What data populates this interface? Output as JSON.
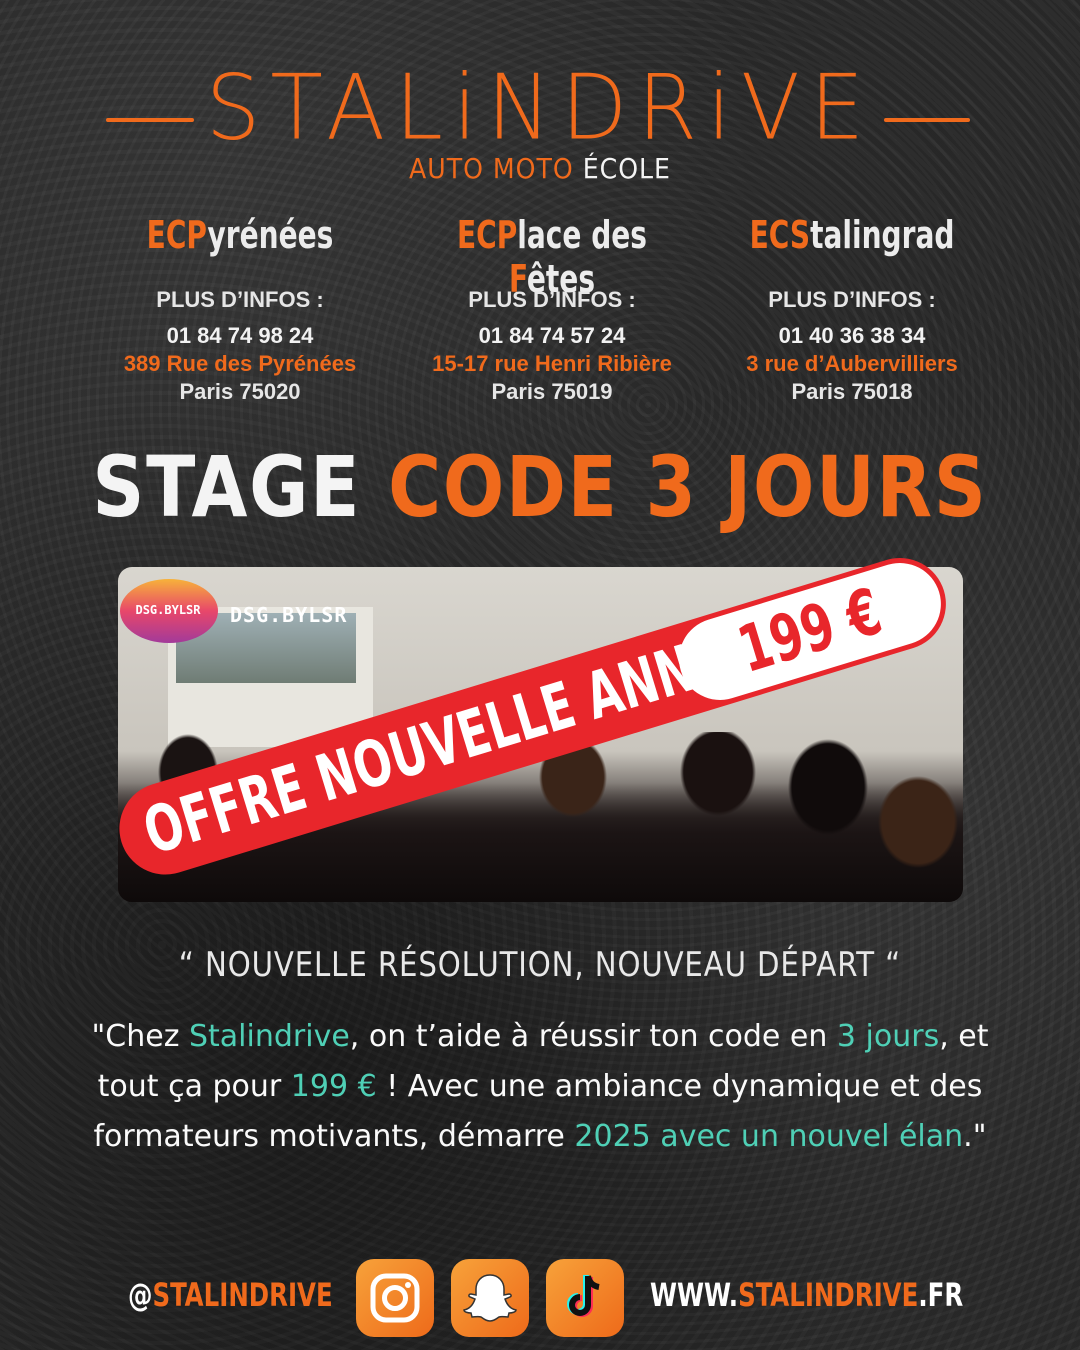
{
  "brand": {
    "name": "STALiNDRiVE",
    "sub_auto": "AUTO",
    "sub_moto": "MOTO",
    "sub_ecole": "ÉCOLE"
  },
  "schools": [
    {
      "prefix": "ECP",
      "rest": "yrénées",
      "info_label": "PLUS D’INFOS :",
      "phone": "01 84 74 98 24",
      "address": "389 Rue des Pyrénées",
      "city": "Paris 75020"
    },
    {
      "prefix": "ECP",
      "part2": "lace des ",
      "part3": "F",
      "part4": "êtes",
      "info_label": "PLUS D’INFOS :",
      "phone": "01 84 74 57 24",
      "address": "15-17 rue Henri Ribière",
      "city": "Paris 75019"
    },
    {
      "prefix": "ECS",
      "rest": "talingrad",
      "info_label": "PLUS D’INFOS :",
      "phone": "01 40 36 38 34",
      "address": "3 rue d’Aubervilliers",
      "city": "Paris 75018"
    }
  ],
  "headline": {
    "word1": "STAGE",
    "word2": "CODE 3 JOURS"
  },
  "promo": {
    "ribbon": "OFFRE NOUVELLE ANNÉE",
    "price": "199 €",
    "watermark_logo": "DSG.BYLSR",
    "watermark_text": "DSG.BYLSR"
  },
  "quote": "“ NOUVELLE RÉSOLUTION, NOUVEAU DÉPART “",
  "paragraph": {
    "p1": "\"Chez ",
    "brand": "Stalindrive",
    "p2": ", on t’aide à réussir ton code en ",
    "days": "3 jours",
    "p3": ", et tout ça pour ",
    "price": "199 €",
    "p4": " ! Avec une ambiance dynamique et des formateurs motivants, démarre ",
    "year": "2025 avec un nouvel élan",
    "p5": ".\""
  },
  "footer": {
    "handle_at": "@",
    "handle": "STALINDRIVE",
    "site_prefix": "WWW.",
    "site_name": "STALINDRIVE",
    "site_suffix": ".FR",
    "icons": [
      "instagram-icon",
      "snapchat-icon",
      "tiktok-icon"
    ]
  },
  "colors": {
    "orange": "#f06a1c",
    "teal": "#4fd0b6",
    "red": "#e8262b",
    "background": "#2b2b2b"
  }
}
